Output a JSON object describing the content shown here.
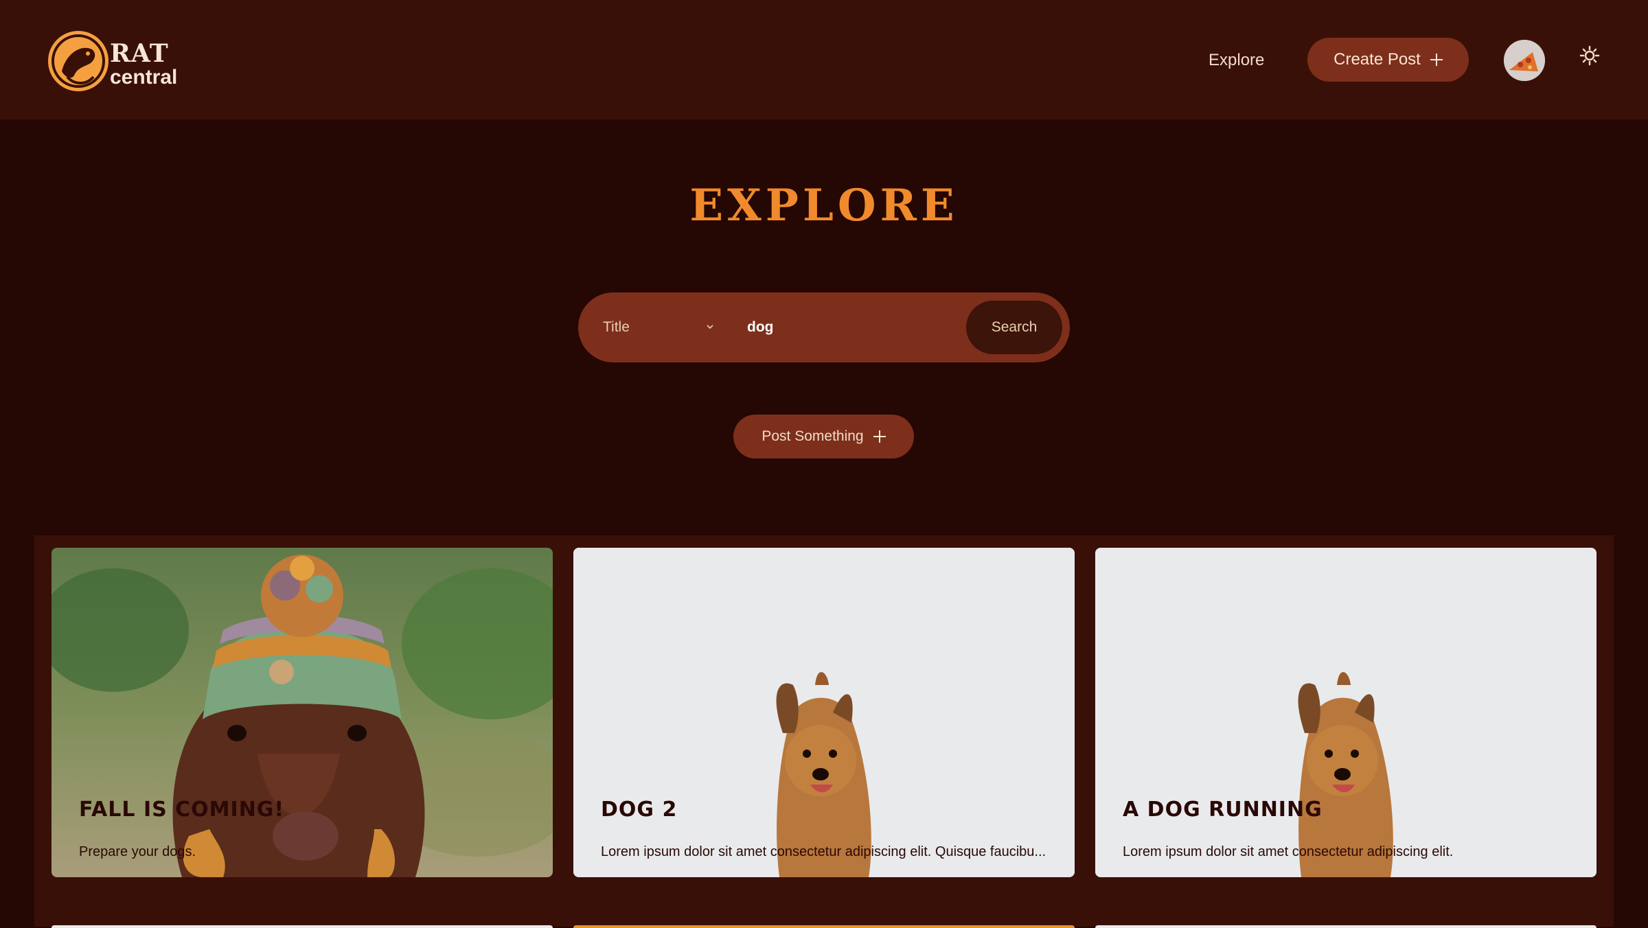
{
  "header": {
    "logo": {
      "line1": "RAT",
      "line2": "central"
    },
    "nav_explore": "Explore",
    "create_post_label": "Create Post"
  },
  "page": {
    "title": "EXPLORE"
  },
  "search": {
    "filter_selected": "Title",
    "query_value": "dog",
    "query_placeholder": "",
    "button_label": "Search"
  },
  "post_something_label": "Post Something",
  "posts": [
    {
      "title": "FALL IS COMING!",
      "description": "Prepare your dogs.",
      "image": "dachshund-in-knit-hat"
    },
    {
      "title": "DOG 2",
      "description": "Lorem ipsum dolor sit amet consectetur adipiscing elit. Quisque faucibu...",
      "image": "dog-running"
    },
    {
      "title": "A DOG RUNNING",
      "description": "Lorem ipsum dolor sit amet consectetur adipiscing elit.",
      "image": "dog-running"
    }
  ],
  "colors": {
    "accent": "#f08a2c",
    "button": "#7d2f1b",
    "header_bg": "#391007",
    "page_bg": "#250704"
  }
}
